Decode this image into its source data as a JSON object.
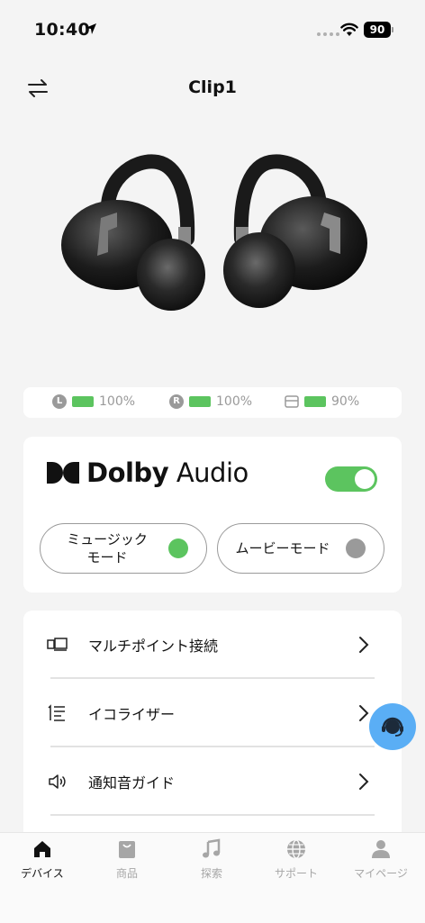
{
  "status_bar": {
    "time": "10:40",
    "battery": "90"
  },
  "header": {
    "title": "Clip1"
  },
  "battery": {
    "left": {
      "badge": "L",
      "percent": "100%"
    },
    "right": {
      "badge": "R",
      "percent": "100%"
    },
    "case": {
      "percent": "90%"
    }
  },
  "dolby": {
    "brand": "Dolby",
    "product": "Audio",
    "enabled": true,
    "modes": [
      {
        "label": "ミュージック\nモード",
        "active": true
      },
      {
        "label": "ムービーモード",
        "active": false
      }
    ]
  },
  "menu": [
    {
      "label": "マルチポイント接続",
      "icon": "multipoint-icon"
    },
    {
      "label": "イコライザー",
      "icon": "equalizer-icon"
    },
    {
      "label": "通知音ガイド",
      "icon": "speaker-icon"
    }
  ],
  "tabs": [
    {
      "label": "デバイス",
      "icon": "home-icon",
      "active": true
    },
    {
      "label": "商品",
      "icon": "shopping-bag-icon",
      "active": false
    },
    {
      "label": "探索",
      "icon": "music-note-icon",
      "active": false
    },
    {
      "label": "サポート",
      "icon": "globe-icon",
      "active": false
    },
    {
      "label": "マイページ",
      "icon": "person-icon",
      "active": false
    }
  ],
  "colors": {
    "accent_green": "#5cc45f",
    "fab_blue": "#5aaef5",
    "inactive_grey": "#9a9a9a"
  }
}
